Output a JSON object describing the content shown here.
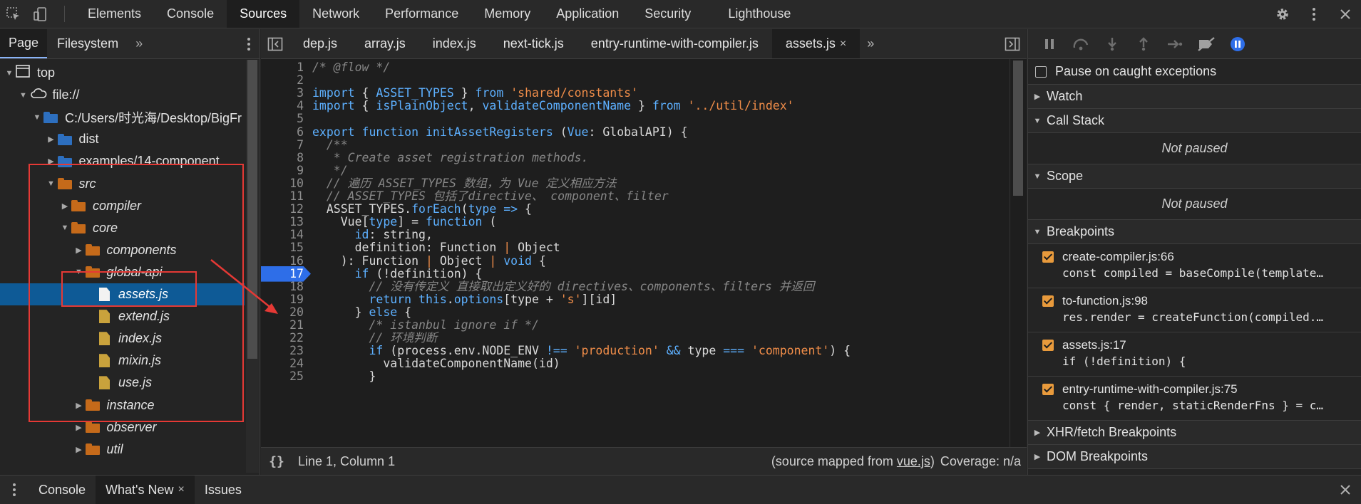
{
  "toolbar": {
    "tabs": [
      "Elements",
      "Console",
      "Sources",
      "Network",
      "Performance",
      "Memory",
      "Application",
      "Security",
      "Lighthouse"
    ],
    "active": "Sources"
  },
  "navigator": {
    "tabs": [
      "Page",
      "Filesystem"
    ],
    "more": "»",
    "tree": [
      {
        "label": "top",
        "level": 0,
        "type": "frame",
        "expanded": true
      },
      {
        "label": "file://",
        "level": 1,
        "type": "cloud",
        "expanded": true
      },
      {
        "label": "C:/Users/时光海/Desktop/BigFr",
        "level": 2,
        "type": "folder-blue",
        "expanded": true
      },
      {
        "label": "dist",
        "level": 3,
        "type": "folder-blue",
        "expanded": false
      },
      {
        "label": "examples/14-component",
        "level": 3,
        "type": "folder-blue",
        "expanded": false
      },
      {
        "label": "src",
        "level": 3,
        "type": "folder-orange",
        "expanded": true,
        "italic": true
      },
      {
        "label": "compiler",
        "level": 4,
        "type": "folder-orange",
        "expanded": false,
        "italic": true
      },
      {
        "label": "core",
        "level": 4,
        "type": "folder-orange",
        "expanded": true,
        "italic": true
      },
      {
        "label": "components",
        "level": 5,
        "type": "folder-orange",
        "expanded": false,
        "italic": true
      },
      {
        "label": "global-api",
        "level": 5,
        "type": "folder-orange",
        "expanded": true,
        "italic": true
      },
      {
        "label": "assets.js",
        "level": 6,
        "type": "file-white",
        "selected": true,
        "italic": true
      },
      {
        "label": "extend.js",
        "level": 6,
        "type": "file",
        "italic": true
      },
      {
        "label": "index.js",
        "level": 6,
        "type": "file",
        "italic": true
      },
      {
        "label": "mixin.js",
        "level": 6,
        "type": "file",
        "italic": true
      },
      {
        "label": "use.js",
        "level": 6,
        "type": "file",
        "italic": true
      },
      {
        "label": "instance",
        "level": 5,
        "type": "folder-orange",
        "expanded": false,
        "italic": true
      },
      {
        "label": "observer",
        "level": 5,
        "type": "folder-orange",
        "expanded": false,
        "italic": true
      },
      {
        "label": "util",
        "level": 5,
        "type": "folder-orange",
        "expanded": false,
        "italic": true
      }
    ]
  },
  "editor": {
    "tabs": [
      "dep.js",
      "array.js",
      "index.js",
      "next-tick.js",
      "entry-runtime-with-compiler.js",
      "assets.js"
    ],
    "active": "assets.js",
    "more": "»",
    "breakpoint_line": 17,
    "lines": [
      {
        "n": "1",
        "html": "<span class='cm'>/* @flow */</span>"
      },
      {
        "n": "2",
        "html": ""
      },
      {
        "n": "3",
        "html": "<span class='kw'>import</span> { <span class='kw'>ASSET_TYPES</span> } <span class='kw'>from</span> <span class='str'>'shared/constants'</span>"
      },
      {
        "n": "4",
        "html": "<span class='kw'>import</span> { <span class='kw'>isPlainObject</span>, <span class='kw'>validateComponentName</span> } <span class='kw'>from</span> <span class='str'>'../util/index'</span>"
      },
      {
        "n": "5",
        "html": ""
      },
      {
        "n": "6",
        "html": "<span class='kw'>export function</span> <span class='kw'>initAssetRegisters</span> (<span class='kw'>Vue</span>: GlobalAPI) {"
      },
      {
        "n": "7",
        "html": "  <span class='cm'>/**</span>"
      },
      {
        "n": "8",
        "html": "<span class='cm'>   * Create asset registration methods.</span>"
      },
      {
        "n": "9",
        "html": "<span class='cm'>   */</span>"
      },
      {
        "n": "10",
        "html": "  <span class='cm'>// 遍历 ASSET_TYPES 数组，为 Vue 定义相应方法</span>"
      },
      {
        "n": "11",
        "html": "  <span class='cm'>// ASSET_TYPES 包括了directive、 component、filter</span>"
      },
      {
        "n": "12",
        "html": "  ASSET_TYPES.<span class='kw'>forEach</span>(<span class='kw'>type</span> <span class='kw'>=&gt;</span> {"
      },
      {
        "n": "13",
        "html": "    Vue[<span class='kw'>type</span>] = <span class='kw'>function</span> ("
      },
      {
        "n": "14",
        "html": "      <span class='kw'>id</span>: string,"
      },
      {
        "n": "15",
        "html": "      definition: Function <span class='str'>|</span> Object"
      },
      {
        "n": "16",
        "html": "    ): Function <span class='str'>|</span> Object <span class='str'>|</span> <span class='kw'>void</span> {"
      },
      {
        "n": "17",
        "html": "      <span class='kw'>if</span> (!definition) {"
      },
      {
        "n": "18",
        "html": "        <span class='cm'>// 没有传定义 直接取出定义好的 directives、components、filters 并返回</span>"
      },
      {
        "n": "19",
        "html": "        <span class='kw'>return this</span>.<span class='kw'>options</span>[type + <span class='str'>'s'</span>][id]"
      },
      {
        "n": "20",
        "html": "      } <span class='kw'>else</span> {"
      },
      {
        "n": "21",
        "html": "        <span class='cm'>/* istanbul ignore if */</span>"
      },
      {
        "n": "22",
        "html": "        <span class='cm'>// 环境判断</span>"
      },
      {
        "n": "23",
        "html": "        <span class='kw'>if</span> (process.env.NODE_ENV <span class='kw'>!==</span> <span class='str'>'production'</span> <span class='kw'>&amp;&amp;</span> type <span class='kw'>===</span> <span class='str'>'component'</span>) {"
      },
      {
        "n": "24",
        "html": "          validateComponentName(id)"
      },
      {
        "n": "25",
        "html": "        }"
      }
    ],
    "status": {
      "braces": "{}",
      "position": "Line 1, Column 1",
      "mapped_prefix": "(source mapped from ",
      "mapped_link": "vue.js",
      "mapped_suffix": ")",
      "coverage": "Coverage: n/a"
    }
  },
  "debugger": {
    "pause_exceptions": "Pause on caught exceptions",
    "sections": {
      "watch": "Watch",
      "call_stack": "Call Stack",
      "scope": "Scope",
      "breakpoints": "Breakpoints",
      "xhr": "XHR/fetch Breakpoints",
      "dom": "DOM Breakpoints"
    },
    "not_paused": "Not paused",
    "breakpoints": [
      {
        "title": "create-compiler.js:66",
        "code": "const compiled = baseCompile(template…"
      },
      {
        "title": "to-function.js:98",
        "code": "res.render = createFunction(compiled.…"
      },
      {
        "title": "assets.js:17",
        "code": "if (!definition) {"
      },
      {
        "title": "entry-runtime-with-compiler.js:75",
        "code": "const { render, staticRenderFns } = c…"
      }
    ]
  },
  "drawer": {
    "tabs": [
      "Console",
      "What's New",
      "Issues"
    ],
    "active": "What's New",
    "close": "×"
  },
  "colors": {
    "accent": "#2e6ee8",
    "annotation": "#e53935",
    "breakpoint_check": "#e89a3c"
  }
}
